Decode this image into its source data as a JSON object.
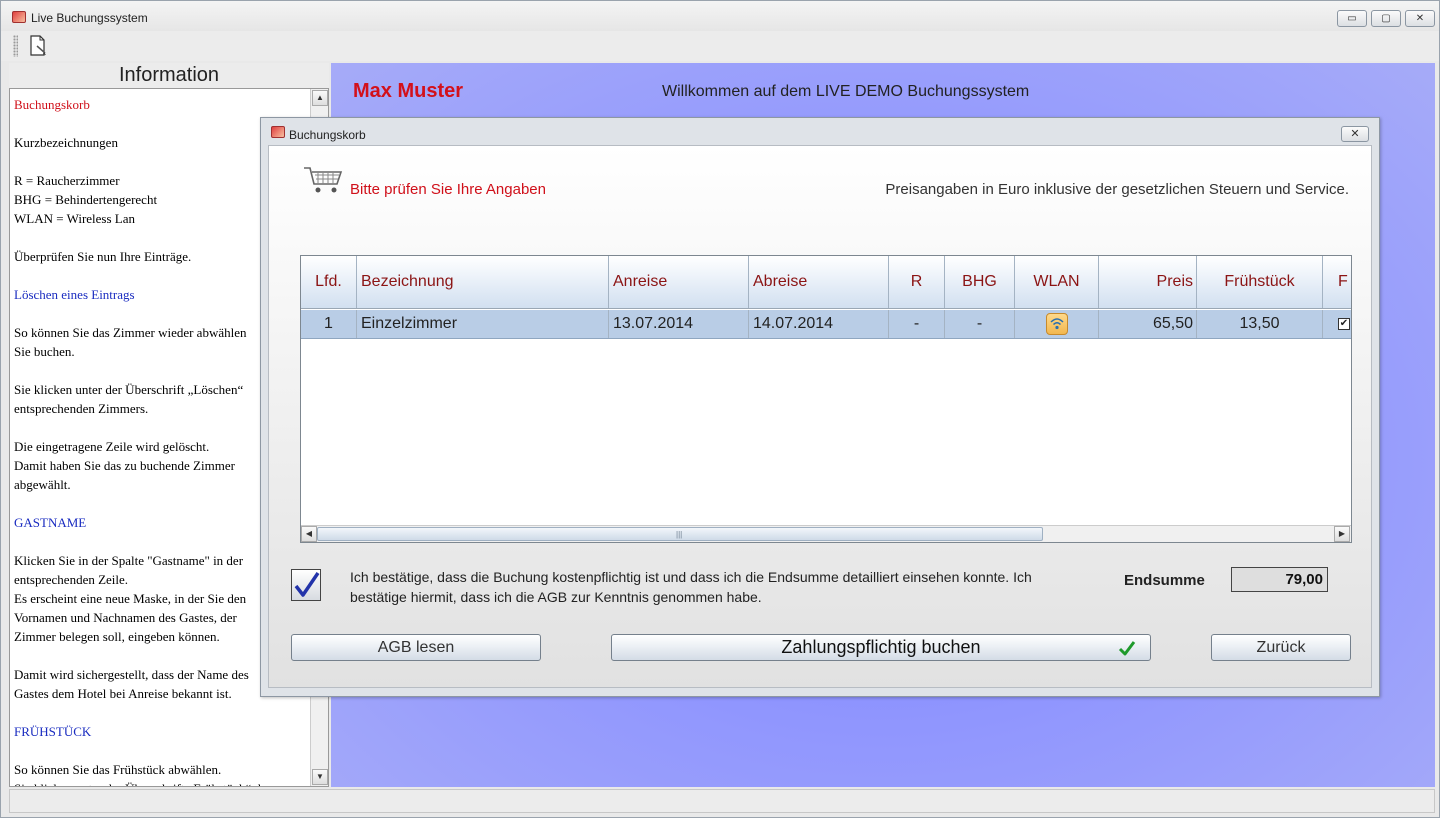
{
  "window": {
    "title": "Live Buchungssystem",
    "controls": {
      "minimize": "▭",
      "maximize": "▢",
      "close": "✕"
    }
  },
  "info": {
    "header": "Information",
    "paragraphs": [
      {
        "lines": [
          "Buchungskorb"
        ],
        "color": "#d0101a"
      },
      {
        "lines": [
          "Kurzbezeichnungen"
        ]
      },
      {
        "lines": [
          "R = Raucherzimmer",
          "BHG = Behindertengerecht",
          "WLAN = Wireless Lan"
        ]
      },
      {
        "lines": [
          "Überprüfen Sie nun Ihre Einträge."
        ]
      },
      {
        "lines": [
          "Löschen eines Eintrags"
        ],
        "color": "#1a2cc0"
      },
      {
        "lines": [
          "So können Sie das Zimmer wieder abwählen",
          "Sie buchen."
        ]
      },
      {
        "lines": [
          "Sie klicken unter der Überschrift „Löschen“",
          "entsprechenden Zimmers."
        ]
      },
      {
        "lines": [
          "Die eingetragene Zeile wird gelöscht.",
          "Damit haben Sie das zu buchende Zimmer",
          "abgewählt."
        ]
      },
      {
        "lines": [
          "GASTNAME"
        ],
        "color": "#1a2cc0"
      },
      {
        "lines": [
          "Klicken Sie in der Spalte \"Gastname\" in der",
          "entsprechenden Zeile.",
          "Es erscheint eine neue Maske, in der Sie den",
          "Vornamen und Nachnamen des Gastes, der",
          "Zimmer belegen soll, eingeben können."
        ]
      },
      {
        "lines": [
          "Damit wird sichergestellt, dass der Name des",
          "Gastes dem Hotel bei Anreise bekannt ist."
        ]
      },
      {
        "lines": [
          "FRÜHSTÜCK"
        ],
        "color": "#1a2cc0"
      },
      {
        "lines": [
          "So können Sie das Frühstück abwählen.",
          "Sie klicken unter der Überschrift „Frühstück“ das"
        ]
      }
    ]
  },
  "main": {
    "user_name": "Max Muster",
    "welcome": "Willkommen auf dem LIVE DEMO Buchungssystem"
  },
  "dialog": {
    "title": "Buchungskorb",
    "close": "✕",
    "prompt": "Bitte prüfen Sie Ihre Angaben",
    "price_note": "Preisangaben in Euro inklusive der gesetzlichen Steuern und Service.",
    "table": {
      "columns": [
        "Lfd.",
        "Bezeichnung",
        "Anreise",
        "Abreise",
        "R",
        "BHG",
        "WLAN",
        "Preis",
        "Frühstück",
        "F"
      ],
      "rows": [
        {
          "lfd": "1",
          "bezeichnung": "Einzelzimmer",
          "anreise": "13.07.2014",
          "abreise": "14.07.2014",
          "r": "-",
          "bhg": "-",
          "wlan_icon": "wifi-icon",
          "preis": "65,50",
          "fruehstueck": "13,50",
          "f_checked": "✔"
        }
      ]
    },
    "confirm_text": "Ich bestätige, dass die Buchung kostenpflichtig ist und dass ich die Endsumme detailliert einsehen konnte. Ich bestätige hiermit, dass ich die AGB zur Kenntnis genommen habe.",
    "confirm_checked": true,
    "sum_label": "Endsumme",
    "sum_value": "79,00",
    "buttons": {
      "agb": "AGB lesen",
      "book": "Zahlungspflichtig buchen",
      "back": "Zurück"
    },
    "colors": {
      "accent_red": "#d0101a",
      "header_text": "#8b1414",
      "selected_row": "#b9cde6"
    }
  }
}
